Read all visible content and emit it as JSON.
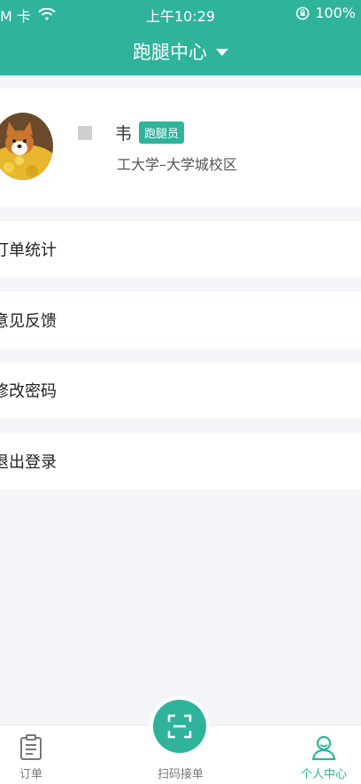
{
  "status_bar": {
    "carrier": "M 卡",
    "time": "上午10:29",
    "battery": "100%"
  },
  "header": {
    "title": "跑腿中心"
  },
  "profile": {
    "name": "韦",
    "badge": "跑腿员",
    "campus": "工大学–大学城校区"
  },
  "menu": {
    "items": [
      {
        "label": "订单统计"
      },
      {
        "label": "意见反馈"
      },
      {
        "label": "修改密码"
      },
      {
        "label": "退出登录"
      }
    ]
  },
  "tabbar": {
    "orders": "订单",
    "scan": "扫码接单",
    "profile": "个人中心"
  },
  "colors": {
    "accent": "#2fb39a"
  }
}
